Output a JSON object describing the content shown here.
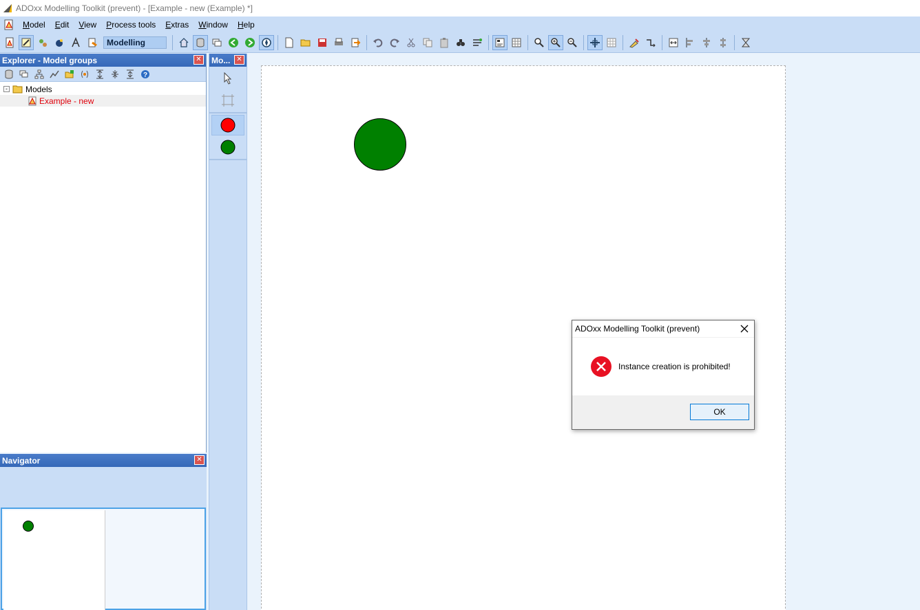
{
  "window": {
    "title": "ADOxx Modelling Toolkit (prevent) - [Example - new (Example) *]"
  },
  "menu": {
    "items": [
      {
        "name": "model",
        "access": "M",
        "rest": "odel"
      },
      {
        "name": "edit",
        "access": "E",
        "rest": "dit"
      },
      {
        "name": "view",
        "access": "V",
        "rest": "iew"
      },
      {
        "name": "process-tools",
        "access": "P",
        "rest": "rocess tools"
      },
      {
        "name": "extras",
        "access": "E",
        "rest": "xtras"
      },
      {
        "name": "window",
        "access": "W",
        "rest": "indow"
      },
      {
        "name": "help",
        "access": "H",
        "rest": "elp"
      }
    ]
  },
  "toolbar": {
    "mode_label": "Modelling"
  },
  "explorer": {
    "title": "Explorer - Model groups",
    "tree": {
      "root": {
        "expander": "-",
        "label": "Models"
      },
      "child": {
        "label": "Example - new"
      }
    }
  },
  "navigator": {
    "title": "Navigator"
  },
  "modelling_bar": {
    "title": "Mo..."
  },
  "canvas": {
    "shapes": [
      {
        "name": "green-circle",
        "color": "#008000"
      }
    ]
  },
  "colors": {
    "red_object": "#ff0000",
    "green_object": "#008000",
    "error_red": "#e81123"
  },
  "dialog": {
    "title": "ADOxx Modelling Toolkit (prevent)",
    "message": "Instance creation is prohibited!",
    "ok_label": "OK",
    "icon": "error-icon"
  }
}
